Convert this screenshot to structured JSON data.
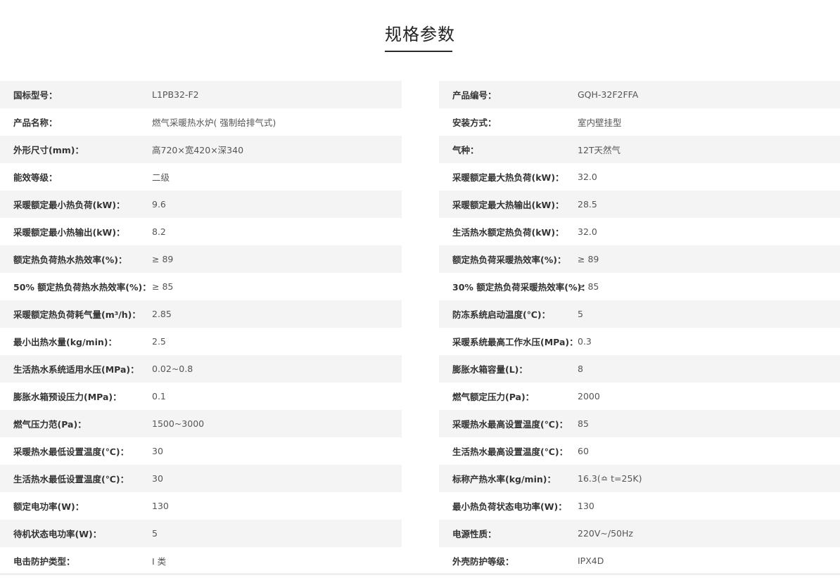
{
  "page": {
    "title": "规格参数"
  },
  "specs": {
    "rows": [
      {
        "left": {
          "label": "国标型号：",
          "value": "L1PB32-F2"
        },
        "right": {
          "label": "产品编号：",
          "value": "GQH-32F2FFA"
        }
      },
      {
        "left": {
          "label": "产品名称：",
          "value": "燃气采暖热水炉( 强制给排气式)"
        },
        "right": {
          "label": "安装方式：",
          "value": "室内壁挂型"
        }
      },
      {
        "left": {
          "label": "外形尺寸(mm)：",
          "value": "高720×宽420×深340"
        },
        "right": {
          "label": "气种：",
          "value": "12T天然气"
        }
      },
      {
        "left": {
          "label": "能效等级：",
          "value": "二级"
        },
        "right": {
          "label": "采暖额定最大热负荷(kW)：",
          "value": "32.0"
        }
      },
      {
        "left": {
          "label": "采暖额定最小热负荷(kW)：",
          "value": "9.6"
        },
        "right": {
          "label": "采暖额定最大热输出(kW)：",
          "value": "28.5"
        }
      },
      {
        "left": {
          "label": "采暖额定最小热输出(kW)：",
          "value": "8.2"
        },
        "right": {
          "label": "生活热水额定热负荷(kW)：",
          "value": "32.0"
        }
      },
      {
        "left": {
          "label": "额定热负荷热水热效率(%)：",
          "value": "≥ 89"
        },
        "right": {
          "label": "额定热负荷采暖热效率(%)：",
          "value": "≥ 89"
        }
      },
      {
        "left": {
          "label": "50% 额定热负荷热水热效率(%)：",
          "value": "≥ 85"
        },
        "right": {
          "label": "30% 额定热负荷采暖热效率(%)：",
          "value": "≥ 85"
        }
      },
      {
        "left": {
          "label": "采暖额定热负荷耗气量(m³/h)：",
          "value": "2.85"
        },
        "right": {
          "label": "防冻系统启动温度(℃)：",
          "value": "5"
        }
      },
      {
        "left": {
          "label": "最小出热水量(kg/min)：",
          "value": "2.5"
        },
        "right": {
          "label": "采暖系统最高工作水压(MPa)：",
          "value": "0.3"
        }
      },
      {
        "left": {
          "label": "生活热水系统适用水压(MPa)：",
          "value": "0.02~0.8"
        },
        "right": {
          "label": "膨胀水箱容量(L)：",
          "value": "8"
        }
      },
      {
        "left": {
          "label": "膨胀水箱预设压力(MPa)：",
          "value": "0.1"
        },
        "right": {
          "label": "燃气额定压力(Pa)：",
          "value": "2000"
        }
      },
      {
        "left": {
          "label": "燃气压力范(Pa)：",
          "value": "1500~3000"
        },
        "right": {
          "label": "采暖热水最高设置温度(℃)：",
          "value": "85"
        }
      },
      {
        "left": {
          "label": "采暖热水最低设置温度(℃)：",
          "value": "30"
        },
        "right": {
          "label": "生活热水最高设置温度(℃)：",
          "value": "60"
        }
      },
      {
        "left": {
          "label": "生活热水最低设置温度(℃)：",
          "value": "30"
        },
        "right": {
          "label": "标称产热水率(kg/min)：",
          "value": "16.3(≏ t=25K)"
        }
      },
      {
        "left": {
          "label": "额定电功率(W)：",
          "value": "130"
        },
        "right": {
          "label": "最小热负荷状态电功率(W)：",
          "value": "130"
        }
      },
      {
        "left": {
          "label": "待机状态电功率(W)：",
          "value": "5"
        },
        "right": {
          "label": "电源性质：",
          "value": "220V~/50Hz"
        }
      },
      {
        "left": {
          "label": "电击防护类型：",
          "value": "I 类"
        },
        "right": {
          "label": "外壳防护等级：",
          "value": "IPX4D"
        }
      }
    ]
  },
  "colors": {
    "row_shade": "#f4f4f4",
    "label_text": "#333333",
    "value_text": "#555555",
    "title_underline": "#2a2a2a"
  }
}
